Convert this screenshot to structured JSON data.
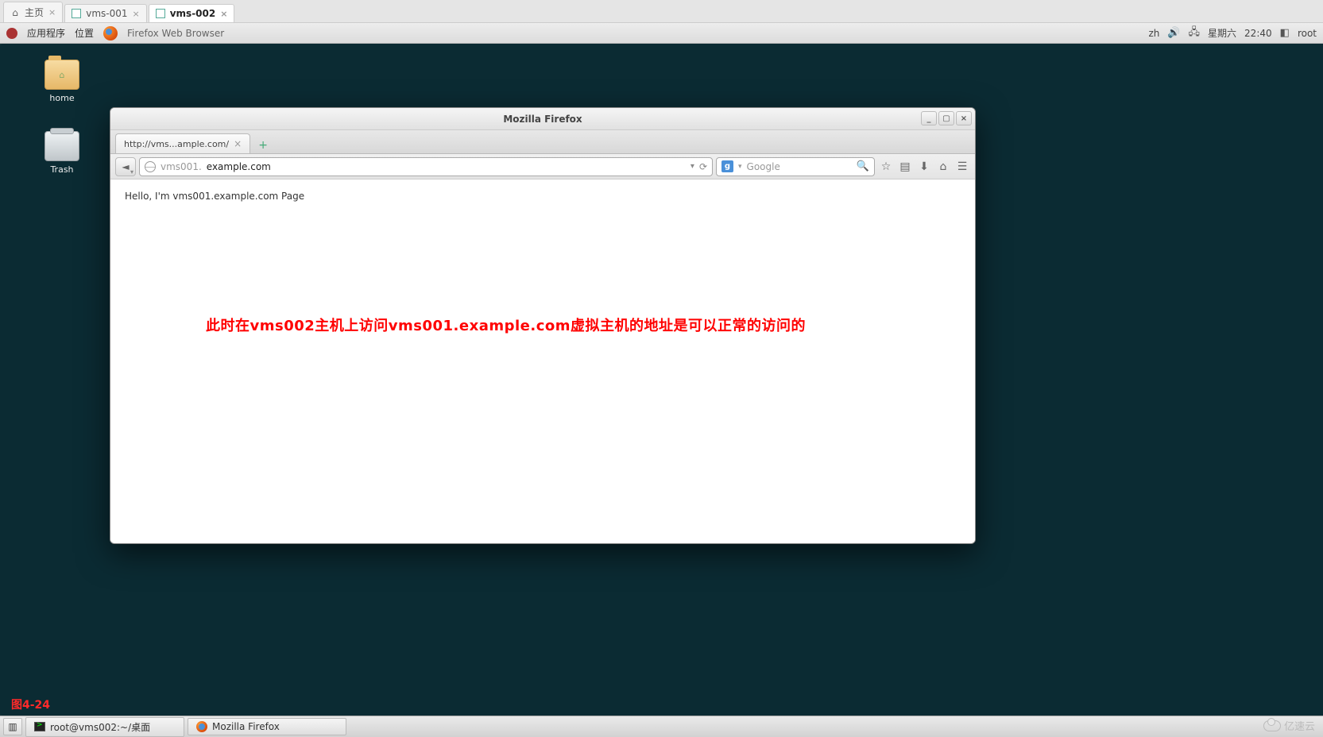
{
  "outer_tabs": {
    "items": [
      {
        "label": "主页",
        "active": false,
        "icon": "home"
      },
      {
        "label": "vms-001",
        "active": false,
        "icon": "square"
      },
      {
        "label": "vms-002",
        "active": true,
        "icon": "square"
      }
    ]
  },
  "gnome_top": {
    "applications": "应用程序",
    "places": "位置",
    "app_name": "Firefox Web Browser",
    "lang": "zh",
    "day": "星期六",
    "time": "22:40",
    "user": "root"
  },
  "desktop_icons": {
    "home": "home",
    "trash": "Trash"
  },
  "firefox": {
    "title": "Mozilla Firefox",
    "tab_label": "http://vms...ample.com/",
    "url_prefix": "vms001.",
    "url_domain": "example.com",
    "reload": "⟳",
    "search_placeholder": "Google",
    "page_text": "Hello, I'm vms001.example.com Page",
    "annotation": "此时在vms002主机上访问vms001.example.com虚拟主机的地址是可以正常的访问的"
  },
  "figure_label": "图4-24",
  "taskbar": {
    "terminal_title": "root@vms002:~/桌面",
    "firefox_title": "Mozilla Firefox"
  },
  "watermark": "亿速云"
}
